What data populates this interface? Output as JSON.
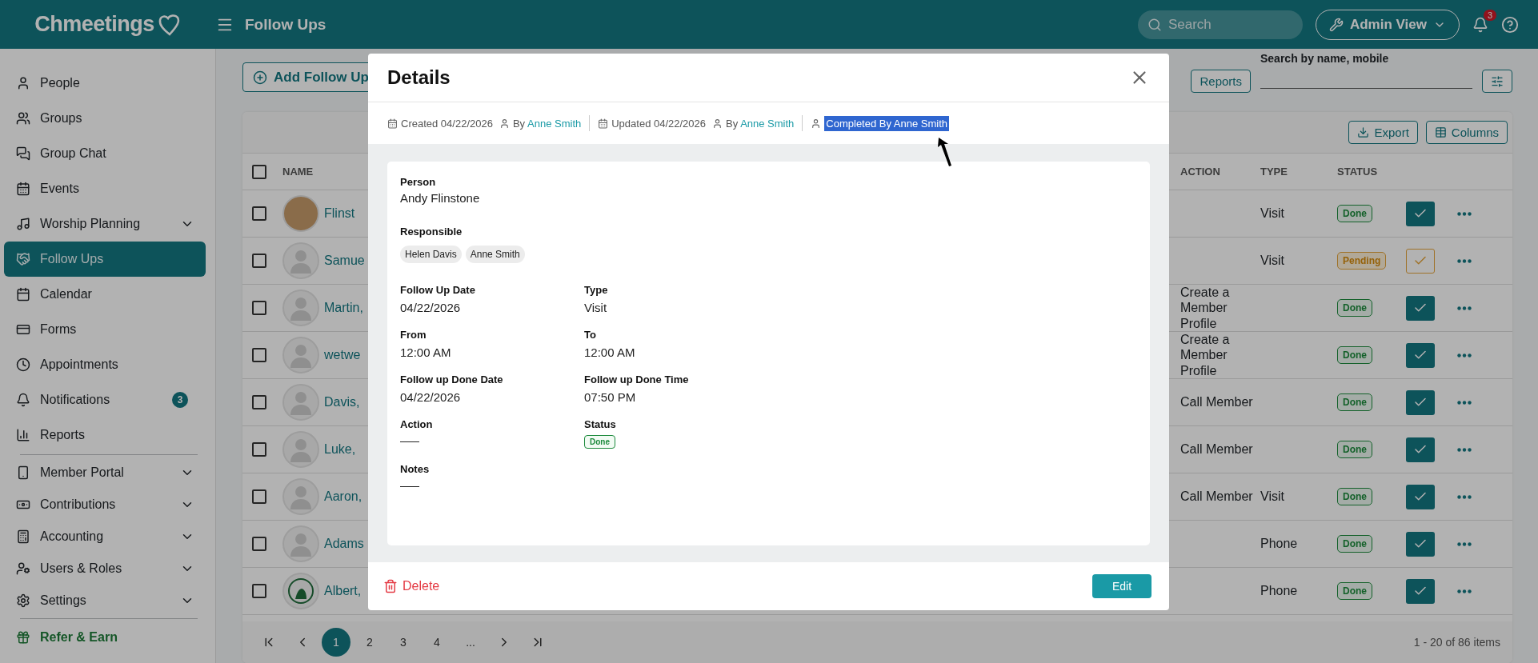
{
  "app": {
    "logo": "Chmeetings"
  },
  "topbar": {
    "title": "Follow Ups",
    "search": {
      "placeholder": "Search"
    },
    "view_button": "Admin View",
    "notifications_badge": "3"
  },
  "sidebar": {
    "sections": [
      {
        "items": [
          {
            "label": "People",
            "selected": false,
            "expandable": false
          },
          {
            "label": "Groups",
            "selected": false,
            "expandable": false
          },
          {
            "label": "Group Chat",
            "selected": false,
            "expandable": false
          },
          {
            "label": "Events",
            "selected": false,
            "expandable": false
          },
          {
            "label": "Worship Planning",
            "selected": false,
            "expandable": true
          },
          {
            "label": "Follow Ups",
            "selected": true,
            "expandable": false
          },
          {
            "label": "Calendar",
            "selected": false,
            "expandable": false
          },
          {
            "label": "Forms",
            "selected": false,
            "expandable": false
          },
          {
            "label": "Appointments",
            "selected": false,
            "expandable": false
          },
          {
            "label": "Notifications",
            "selected": false,
            "expandable": false,
            "badge": "3"
          },
          {
            "label": "Reports",
            "selected": false,
            "expandable": false
          }
        ]
      },
      {
        "items": [
          {
            "label": "Member Portal",
            "selected": false,
            "expandable": true
          },
          {
            "label": "Contributions",
            "selected": false,
            "expandable": true
          },
          {
            "label": "Accounting",
            "selected": false,
            "expandable": true
          },
          {
            "label": "Users & Roles",
            "selected": false,
            "expandable": true
          },
          {
            "label": "Settings",
            "selected": false,
            "expandable": true
          }
        ]
      }
    ],
    "refer": "Refer & Earn"
  },
  "toolbar": {
    "add_button": "Add Follow Up",
    "reports_button": "Reports",
    "search": {
      "label": "Search by name, mobile"
    },
    "export_button": "Export",
    "columns_button": "Columns"
  },
  "table": {
    "header_checked": false,
    "columns": [
      "NAME",
      "ACTION",
      "TYPE",
      "STATUS"
    ],
    "rows": [
      {
        "name": "Flinst",
        "kind": "photo",
        "action": "",
        "type": "Visit",
        "status": "Done",
        "completed": true,
        "checked": false
      },
      {
        "name": "Samue",
        "kind": "silhouette",
        "action": "",
        "type": "Visit",
        "status": "Pending",
        "completed": false,
        "checked": false
      },
      {
        "name": "Martin,",
        "kind": "silhouette",
        "action": "Create a Member Profile",
        "type": "",
        "status": "Done",
        "completed": true,
        "checked": false
      },
      {
        "name": "wetwe",
        "kind": "silhouette",
        "action": "Create a Member Profile",
        "type": "",
        "status": "Done",
        "completed": true,
        "checked": false
      },
      {
        "name": "Davis,",
        "kind": "silhouette",
        "action": "Call Member",
        "type": "",
        "status": "Done",
        "completed": true,
        "checked": false
      },
      {
        "name": "Luke,",
        "kind": "silhouette",
        "action": "Call Member",
        "type": "",
        "status": "Done",
        "completed": true,
        "checked": false
      },
      {
        "name": "Aaron,",
        "kind": "silhouette",
        "action": "Call Member",
        "type": "Visit",
        "status": "Done",
        "completed": true,
        "checked": false
      },
      {
        "name": "Adams",
        "kind": "silhouette",
        "action": "",
        "type": "Phone",
        "status": "Done",
        "completed": true,
        "checked": false
      },
      {
        "name": "Albert,",
        "kind": "logo",
        "action": "",
        "type": "Phone",
        "status": "Done",
        "completed": true,
        "checked": false
      }
    ]
  },
  "pagination": {
    "pages": [
      {
        "label": "1",
        "selected": true
      },
      {
        "label": "2",
        "selected": false
      },
      {
        "label": "3",
        "selected": false
      },
      {
        "label": "4",
        "selected": false
      },
      {
        "label": "...",
        "selected": false
      }
    ],
    "summary": "1 - 20 of 86 items"
  },
  "dialog": {
    "title": "Details",
    "meta": [
      {
        "kind": "date",
        "text": "Created 04/22/2026",
        "highlighted": false
      },
      {
        "kind": "by",
        "text": "By",
        "link": "Anne Smith",
        "highlighted": false
      },
      {
        "kind": "date",
        "text": "Updated 04/22/2026",
        "highlighted": false
      },
      {
        "kind": "by",
        "text": "By",
        "link": "Anne Smith",
        "highlighted": false
      },
      {
        "kind": "person",
        "text": "Completed By Anne Smith",
        "highlighted": true
      }
    ],
    "person": {
      "label": "Person",
      "value": "Andy Flinstone"
    },
    "responsible": {
      "label": "Responsible",
      "chips": [
        "Helen Davis",
        "Anne Smith"
      ]
    },
    "fields": [
      {
        "label": "Follow Up Date",
        "value": "04/22/2026",
        "kind": "text"
      },
      {
        "label": "Type",
        "value": "Visit",
        "kind": "text"
      },
      {
        "label": "From",
        "value": "12:00 AM",
        "kind": "text"
      },
      {
        "label": "To",
        "value": "12:00 AM",
        "kind": "text"
      },
      {
        "label": "Follow up Done Date",
        "value": "04/22/2026",
        "kind": "text"
      },
      {
        "label": "Follow up Done Time",
        "value": "07:50 PM",
        "kind": "text"
      },
      {
        "label": "Action",
        "kind": "empty"
      },
      {
        "label": "Status",
        "value": "Done",
        "kind": "badge"
      },
      {
        "label": "Notes",
        "kind": "empty"
      }
    ],
    "delete_button": "Delete",
    "edit_button": "Edit"
  }
}
